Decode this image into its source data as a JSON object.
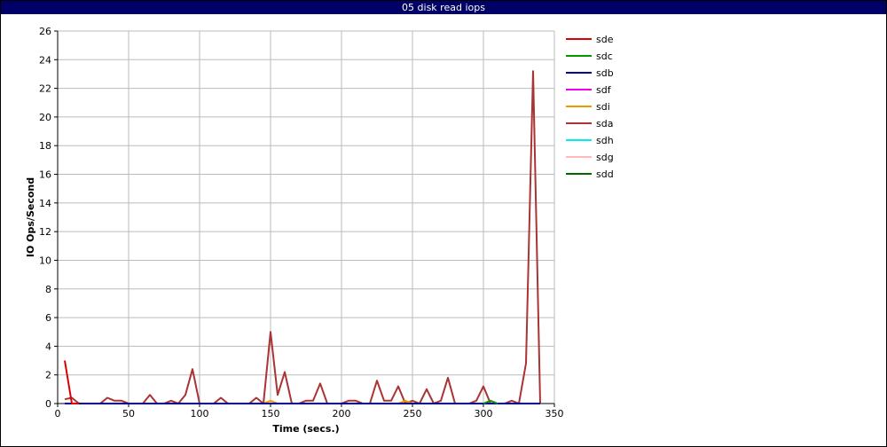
{
  "window": {
    "title": "05 disk read iops"
  },
  "chart_data": {
    "type": "line",
    "title": "05 disk read iops",
    "xlabel": "Time (secs.)",
    "ylabel": "IO Ops/Second",
    "xlim": [
      0,
      350
    ],
    "ylim": [
      0,
      26
    ],
    "xticks": [
      0,
      50,
      100,
      150,
      200,
      250,
      300,
      350
    ],
    "yticks": [
      0,
      2,
      4,
      6,
      8,
      10,
      12,
      14,
      16,
      18,
      20,
      22,
      24,
      26
    ],
    "grid": true,
    "legend_position": "right",
    "series": [
      {
        "name": "sde",
        "color": "#dd0000",
        "x": [
          5,
          10,
          15
        ],
        "y": [
          3.0,
          0,
          0
        ]
      },
      {
        "name": "sdc",
        "color": "#009900",
        "x": [
          300,
          305,
          310
        ],
        "y": [
          0,
          0.2,
          0
        ]
      },
      {
        "name": "sdb",
        "color": "#000099",
        "x": [
          5,
          340
        ],
        "y": [
          0,
          0
        ]
      },
      {
        "name": "sdf",
        "color": "#ee00ee",
        "x": [
          5,
          340
        ],
        "y": [
          0,
          0
        ]
      },
      {
        "name": "sdi",
        "color": "#ee9900",
        "x": [
          145,
          150,
          155,
          240,
          245,
          250
        ],
        "y": [
          0,
          0.2,
          0,
          0,
          0.2,
          0
        ]
      },
      {
        "name": "sda",
        "color": "#aa3333",
        "x": [
          5,
          10,
          15,
          20,
          25,
          30,
          35,
          40,
          45,
          50,
          55,
          60,
          65,
          70,
          75,
          80,
          85,
          90,
          95,
          100,
          105,
          110,
          115,
          120,
          125,
          130,
          135,
          140,
          145,
          150,
          155,
          160,
          165,
          170,
          175,
          180,
          185,
          190,
          195,
          200,
          205,
          210,
          215,
          220,
          225,
          230,
          235,
          240,
          245,
          250,
          255,
          260,
          265,
          270,
          275,
          280,
          285,
          290,
          295,
          300,
          305,
          310,
          315,
          320,
          325,
          330,
          335,
          340
        ],
        "y": [
          0.3,
          0.4,
          0,
          0,
          0,
          0,
          0.4,
          0.2,
          0.2,
          0,
          0,
          0,
          0.6,
          0,
          0,
          0.2,
          0,
          0.6,
          2.4,
          0,
          0,
          0,
          0.4,
          0,
          0,
          0,
          0,
          0.4,
          0,
          5.0,
          0.6,
          2.2,
          0,
          0,
          0.2,
          0.2,
          1.4,
          0,
          0,
          0,
          0.2,
          0.2,
          0,
          0,
          1.6,
          0.2,
          0.2,
          1.2,
          0,
          0.2,
          0,
          1.0,
          0,
          0.2,
          1.8,
          0,
          0,
          0,
          0.2,
          1.2,
          0,
          0,
          0,
          0.2,
          0,
          2.8,
          23.2,
          0
        ]
      },
      {
        "name": "sdh",
        "color": "#00eeee",
        "x": [
          5,
          340
        ],
        "y": [
          0,
          0
        ]
      },
      {
        "name": "sdg",
        "color": "#ffbbbb",
        "x": [
          5,
          340
        ],
        "y": [
          0,
          0
        ]
      },
      {
        "name": "sdd",
        "color": "#006600",
        "x": [
          5,
          340
        ],
        "y": [
          0,
          0
        ]
      }
    ]
  }
}
